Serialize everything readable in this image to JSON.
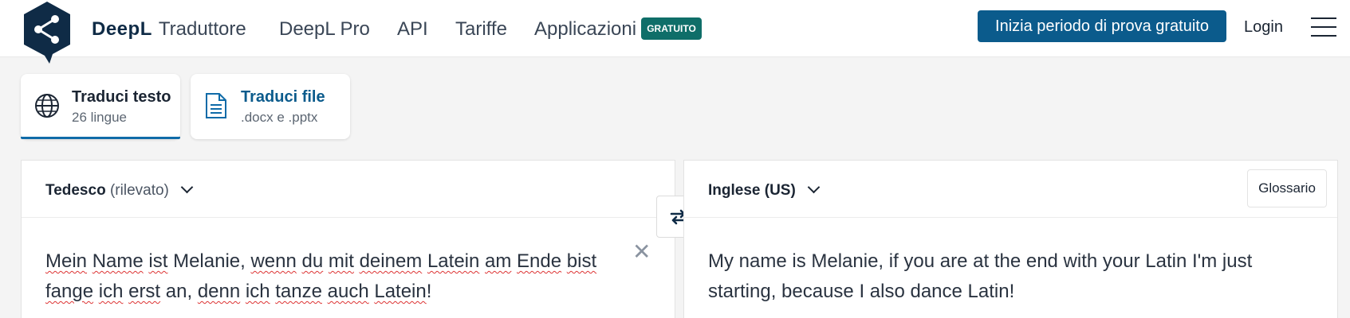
{
  "header": {
    "brand": "DeepL",
    "brand_product": "Traduttore",
    "nav": [
      "DeepL Pro",
      "API",
      "Tariffe",
      "Applicazioni"
    ],
    "badge": "GRATUITO",
    "trial_button": "Inizia periodo di prova gratuito",
    "login": "Login"
  },
  "tabs": [
    {
      "title": "Traduci testo",
      "subtitle": "26 lingue",
      "active": true
    },
    {
      "title": "Traduci file",
      "subtitle": ".docx e .pptx",
      "active": false
    }
  ],
  "source": {
    "language": "Tedesco",
    "detected": "(rilevato)",
    "text": "Mein Name ist Melanie, wenn du mit deinem Latein am Ende bist fange ich erst an, denn ich tanze auch Latein!"
  },
  "target": {
    "language": "Inglese (US)",
    "glossary_button": "Glossario",
    "text": "My name is Melanie, if you are at the end with your Latin I'm just starting, because I also dance Latin!"
  },
  "colors": {
    "brand_dark": "#0f2b46",
    "accent_blue": "#0b5b8c",
    "badge_green": "#0f6e69",
    "active_tab_underline": "#0f6ba8"
  },
  "icons": [
    "deepl-logo-icon",
    "globe-icon",
    "document-icon",
    "chevron-down-icon",
    "swap-icon",
    "close-icon",
    "hamburger-menu-icon"
  ]
}
